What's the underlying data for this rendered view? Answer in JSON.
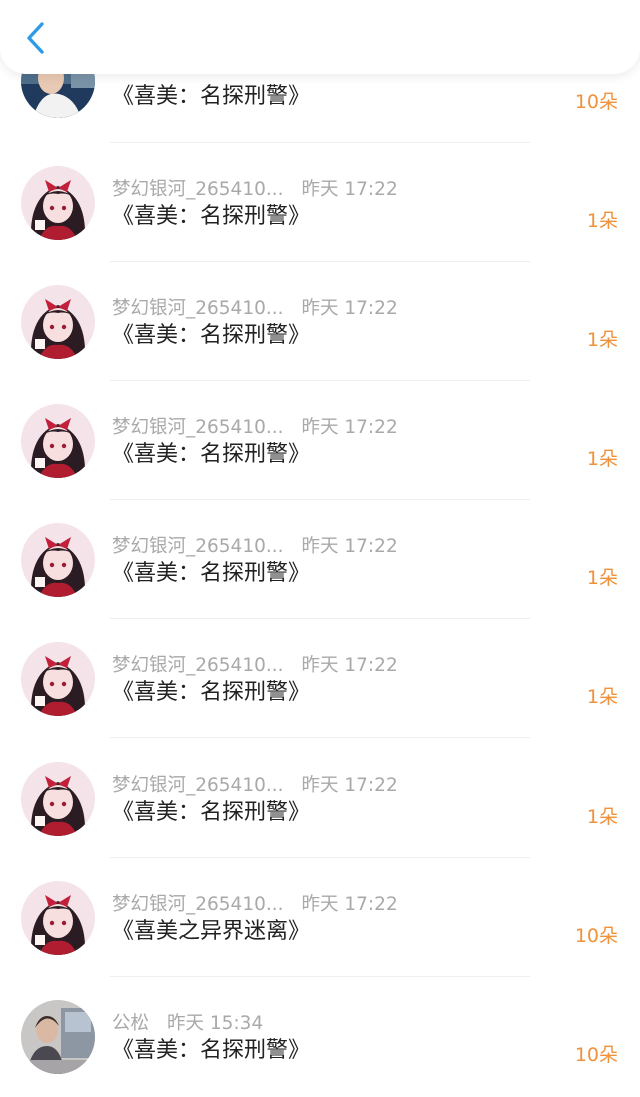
{
  "header": {
    "back_icon": "chevron-left-icon",
    "accent_color": "#2f9be8"
  },
  "colors": {
    "amount": "#f0913c",
    "meta": "#a9a9a9",
    "title": "#222222"
  },
  "rows": [
    {
      "name": "",
      "time": "",
      "title": "《喜美：名探刑警》",
      "amount": "10朵",
      "avatar": "photo-avatar"
    },
    {
      "name": "梦幻银河_265410...",
      "time": "昨天 17:22",
      "title": "《喜美：名探刑警》",
      "amount": "1朵",
      "avatar": "anime-girl-avatar"
    },
    {
      "name": "梦幻银河_265410...",
      "time": "昨天 17:22",
      "title": "《喜美：名探刑警》",
      "amount": "1朵",
      "avatar": "anime-girl-avatar"
    },
    {
      "name": "梦幻银河_265410...",
      "time": "昨天 17:22",
      "title": "《喜美：名探刑警》",
      "amount": "1朵",
      "avatar": "anime-girl-avatar"
    },
    {
      "name": "梦幻银河_265410...",
      "time": "昨天 17:22",
      "title": "《喜美：名探刑警》",
      "amount": "1朵",
      "avatar": "anime-girl-avatar"
    },
    {
      "name": "梦幻银河_265410...",
      "time": "昨天 17:22",
      "title": "《喜美：名探刑警》",
      "amount": "1朵",
      "avatar": "anime-girl-avatar"
    },
    {
      "name": "梦幻银河_265410...",
      "time": "昨天 17:22",
      "title": "《喜美：名探刑警》",
      "amount": "1朵",
      "avatar": "anime-girl-avatar"
    },
    {
      "name": "梦幻银河_265410...",
      "time": "昨天 17:22",
      "title": "《喜美之异界迷离》",
      "amount": "10朵",
      "avatar": "anime-girl-avatar"
    },
    {
      "name": "公松",
      "time": "昨天 15:34",
      "title": "《喜美：名探刑警》",
      "amount": "10朵",
      "avatar": "photo-avatar"
    }
  ]
}
